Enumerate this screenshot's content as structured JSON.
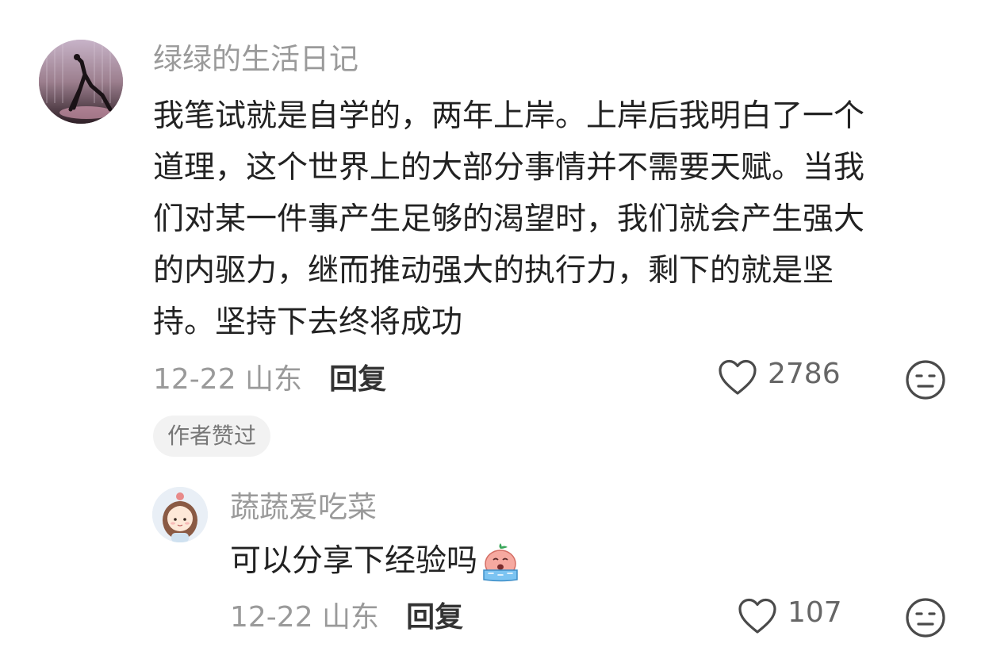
{
  "comment": {
    "username": "绿绿的生活日记",
    "avatar_icon": "dancer-photo-avatar",
    "lines": [
      "我笔试就是自学的，两年上岸。上岸后我明白了一个",
      "道理，这个世界上的大部分事情并不需要天赋。当我",
      "们对某一件事产生足够的渴望时，我们就会产生强大",
      "的内驱力，继而推动强大的执行力，剩下的就是坚",
      "持。坚持下去终将成功"
    ],
    "date_location": "12-22 山东",
    "reply_label": "回复",
    "like_count": "2786",
    "author_badge": "作者赞过",
    "like_icon": "heart-outline-icon",
    "dislike_icon": "unhappy-face-icon"
  },
  "reply": {
    "username": "蔬蔬爱吃菜",
    "avatar_icon": "cartoon-girl-avatar",
    "text": "可以分享下经验吗",
    "emoji": "crying-emoji",
    "date_location": "12-22 山东",
    "reply_label": "回复",
    "like_count": "107",
    "like_icon": "heart-outline-icon",
    "dislike_icon": "unhappy-face-icon"
  }
}
